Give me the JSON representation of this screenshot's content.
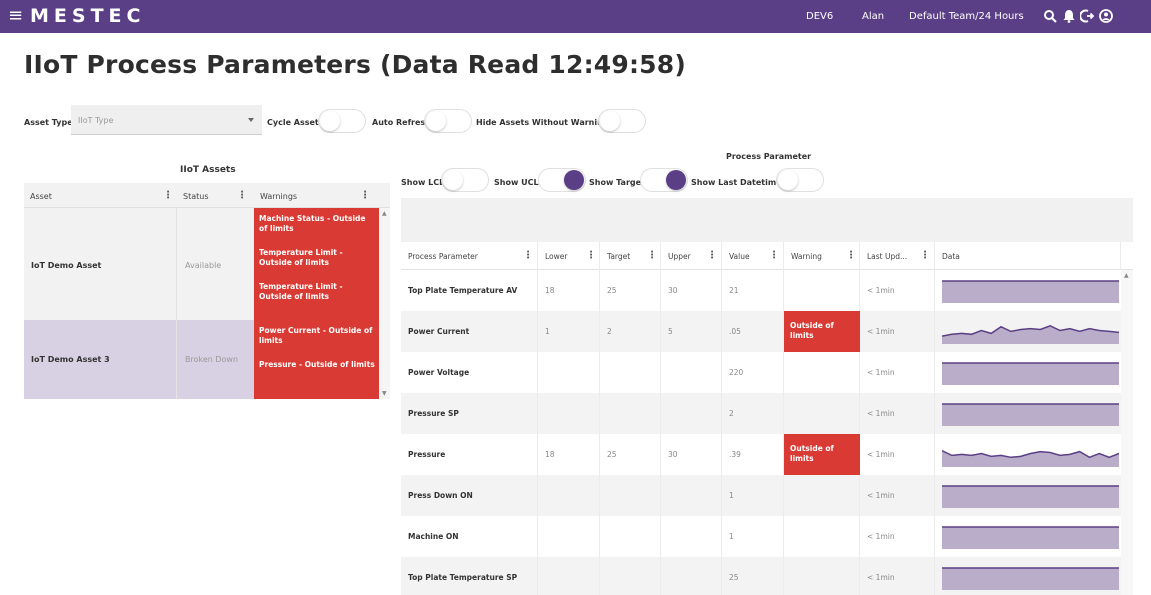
{
  "topbar": {
    "menu_icon": "menu-icon",
    "logo": "MESTEC",
    "env": "DEV6",
    "user": "Alan",
    "team": "Default Team/24 Hours",
    "icons": [
      "search-icon",
      "bell-icon",
      "logout-icon",
      "user-icon"
    ]
  },
  "page": {
    "title": "IIoT Process Parameters (Data Read 12:49:58)"
  },
  "filters": {
    "asset_type_label": "Asset Type",
    "asset_type_placeholder": "IIoT Type",
    "cycle_assets_label": "Cycle Assets",
    "cycle_assets_on": false,
    "auto_refresh_label": "Auto Refresh",
    "auto_refresh_on": false,
    "hide_assets_label": "Hide Assets Without Warning",
    "hide_assets_on": false
  },
  "assets": {
    "caption": "IIoT Assets",
    "columns": [
      "Asset",
      "Status",
      "Warnings"
    ],
    "rows": [
      {
        "asset": "IoT Demo Asset",
        "status": "Available",
        "warnings": [
          "Machine Status - Outside of limits",
          "Temperature Limit - Outside of limits",
          "Temperature Limit - Outside of limits"
        ]
      },
      {
        "asset": "IoT Demo Asset 3",
        "status": "Broken Down",
        "warnings": [
          "Power Current - Outside of limits",
          "Pressure - Outside of limits"
        ]
      }
    ]
  },
  "process": {
    "caption": "Process Parameter",
    "show_lcl_label": "Show LCL",
    "show_lcl_on": false,
    "show_ucl_label": "Show UCL",
    "show_ucl_on": true,
    "show_target_label": "Show Target",
    "show_target_on": true,
    "show_last_datetime_label": "Show Last Datetime",
    "show_last_datetime_on": false,
    "columns": [
      "Process Parameter",
      "Lower",
      "Target",
      "Upper",
      "Value",
      "Warning",
      "Last Upd...",
      "Data"
    ],
    "rows": [
      {
        "name": "Top Plate Temperature AV",
        "lower": "18",
        "target": "25",
        "upper": "30",
        "value": "21",
        "warning": "",
        "last": "< 1min",
        "spark": [
          0.5,
          0.5,
          0.5,
          0.5,
          0.5,
          0.5,
          0.5,
          0.5,
          0.5,
          0.5,
          0.5,
          0.5,
          0.5,
          0.5,
          0.5,
          0.5,
          0.5,
          0.5,
          0.5
        ]
      },
      {
        "name": "Power Current",
        "lower": "1",
        "target": "2",
        "upper": "5",
        "value": ".05",
        "warning": "Outside of limits",
        "last": "< 1min",
        "spark": [
          0.2,
          0.3,
          0.35,
          0.3,
          0.5,
          0.35,
          0.7,
          0.45,
          0.55,
          0.6,
          0.55,
          0.75,
          0.5,
          0.6,
          0.45,
          0.6,
          0.5,
          0.45,
          0.4
        ]
      },
      {
        "name": "Power Voltage",
        "lower": "",
        "target": "",
        "upper": "",
        "value": "220",
        "warning": "",
        "last": "< 1min",
        "spark": [
          0.5,
          0.5,
          0.5,
          0.5,
          0.5,
          0.5,
          0.5,
          0.5,
          0.5,
          0.5,
          0.5,
          0.5,
          0.5,
          0.5,
          0.5,
          0.5,
          0.5,
          0.5,
          0.5
        ]
      },
      {
        "name": "Pressure SP",
        "lower": "",
        "target": "",
        "upper": "",
        "value": "2",
        "warning": "",
        "last": "< 1min",
        "spark": [
          0.5,
          0.5,
          0.5,
          0.5,
          0.5,
          0.5,
          0.5,
          0.5,
          0.5,
          0.5,
          0.5,
          0.5,
          0.5,
          0.5,
          0.5,
          0.5,
          0.5,
          0.5,
          0.5
        ]
      },
      {
        "name": "Pressure",
        "lower": "18",
        "target": "25",
        "upper": "30",
        "value": ".39",
        "warning": "Outside of limits",
        "last": "< 1min",
        "spark": [
          0.65,
          0.4,
          0.45,
          0.4,
          0.5,
          0.35,
          0.4,
          0.3,
          0.35,
          0.5,
          0.6,
          0.55,
          0.4,
          0.45,
          0.6,
          0.3,
          0.5,
          0.3,
          0.5
        ]
      },
      {
        "name": "Press Down ON",
        "lower": "",
        "target": "",
        "upper": "",
        "value": "1",
        "warning": "",
        "last": "< 1min",
        "spark": [
          0.5,
          0.5,
          0.5,
          0.5,
          0.5,
          0.5,
          0.5,
          0.5,
          0.5,
          0.5,
          0.5,
          0.5,
          0.5,
          0.5,
          0.5,
          0.5,
          0.5,
          0.5,
          0.5
        ]
      },
      {
        "name": "Machine ON",
        "lower": "",
        "target": "",
        "upper": "",
        "value": "1",
        "warning": "",
        "last": "< 1min",
        "spark": [
          0.5,
          0.5,
          0.5,
          0.5,
          0.5,
          0.5,
          0.5,
          0.5,
          0.5,
          0.5,
          0.5,
          0.5,
          0.5,
          0.5,
          0.5,
          0.5,
          0.5,
          0.5,
          0.5
        ]
      },
      {
        "name": "Top Plate Temperature SP",
        "lower": "",
        "target": "",
        "upper": "",
        "value": "25",
        "warning": "",
        "last": "< 1min",
        "spark": [
          0.5,
          0.5,
          0.5,
          0.5,
          0.5,
          0.5,
          0.5,
          0.5,
          0.5,
          0.5,
          0.5,
          0.5,
          0.5,
          0.5,
          0.5,
          0.5,
          0.5,
          0.5,
          0.5
        ]
      }
    ]
  },
  "colors": {
    "brand": "#5b3f86",
    "warning": "#d93a34",
    "spark_fill": "#b9adc9",
    "spark_line": "#5b3f86"
  }
}
